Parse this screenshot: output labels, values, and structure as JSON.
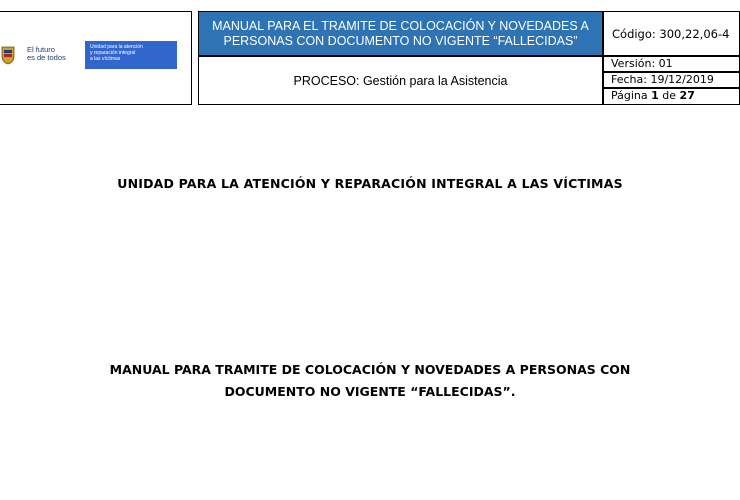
{
  "header": {
    "logo": {
      "tagline_line1": "El futuro",
      "tagline_line2": "es de todos",
      "entity_line1": "Unidad para la atención",
      "entity_line2": "y reparación integral",
      "entity_line3": "a las víctimas"
    },
    "manual_line1": "MANUAL PARA EL TRAMITE DE COLOCACIÓN Y NOVEDADES A",
    "manual_line2": "PERSONAS CON DOCUMENTO NO VIGENTE “FALLECIDAS”",
    "code": "Código: 300,22,06-4",
    "process": "PROCESO: Gestión para la Asistencia",
    "version": "Versión: 01",
    "date": "Fecha: 19/12/2019",
    "page_label": "Página",
    "page_current": "1",
    "page_of": "de",
    "page_total": "27"
  },
  "body": {
    "entity_title": "UNIDAD PARA LA ATENCIÓN Y REPARACIÓN INTEGRAL A LAS VÍCTIMAS",
    "doc_title_line1": "MANUAL PARA TRAMITE DE COLOCACIÓN Y NOVEDADES A PERSONAS CON",
    "doc_title_line2": "DOCUMENTO NO VIGENTE “FALLECIDAS”."
  },
  "colors": {
    "header_blue": "#2e74b5",
    "logo_blue": "#3366cc"
  }
}
